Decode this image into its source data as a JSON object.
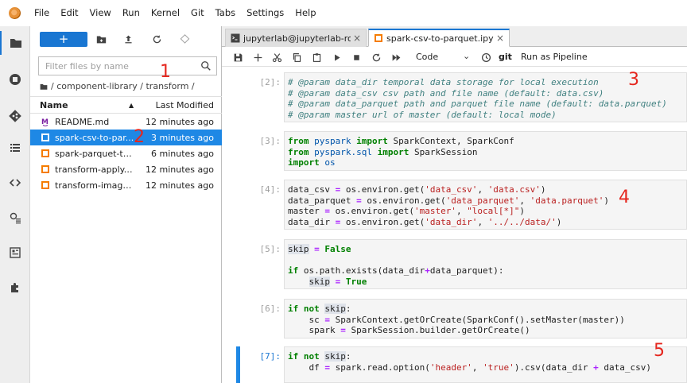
{
  "menubar": {
    "items": [
      "File",
      "Edit",
      "View",
      "Run",
      "Kernel",
      "Git",
      "Tabs",
      "Settings",
      "Help"
    ]
  },
  "filebrowser": {
    "new_label": "+",
    "search_placeholder": "Filter files by name",
    "breadcrumb": "/ component-library / transform /",
    "columns": {
      "name": "Name",
      "modified": "Last Modified"
    },
    "files": [
      {
        "name": "README.md",
        "modified": "12 minutes ago",
        "icon": "markdown-icon"
      },
      {
        "name": "spark-csv-to-par...",
        "modified": "3 minutes ago",
        "icon": "notebook-icon"
      },
      {
        "name": "spark-parquet-to...",
        "modified": "6 minutes ago",
        "icon": "notebook-icon"
      },
      {
        "name": "transform-apply.i...",
        "modified": "12 minutes ago",
        "icon": "notebook-icon"
      },
      {
        "name": "transform-image...",
        "modified": "12 minutes ago",
        "icon": "notebook-icon"
      }
    ]
  },
  "tabs": [
    {
      "label": "jupyterlab@jupyterlab-rom",
      "close": "×"
    },
    {
      "label": "spark-csv-to-parquet.ipynb",
      "close": "×"
    }
  ],
  "notebook_toolbar": {
    "cell_type": "Code",
    "git_label": "git",
    "pipeline_label": "Run as Pipeline"
  },
  "cells": [
    {
      "prompt": "[2]:"
    },
    {
      "prompt": "[3]:"
    },
    {
      "prompt": "[4]:"
    },
    {
      "prompt": "[5]:"
    },
    {
      "prompt": "[6]:"
    },
    {
      "prompt": "[7]:"
    }
  ],
  "annotations": [
    "1",
    "2",
    "3",
    "4",
    "5"
  ],
  "colors": {
    "accent": "#1976d2",
    "selected_row": "#1e88e5",
    "annotation": "#e5261e"
  }
}
